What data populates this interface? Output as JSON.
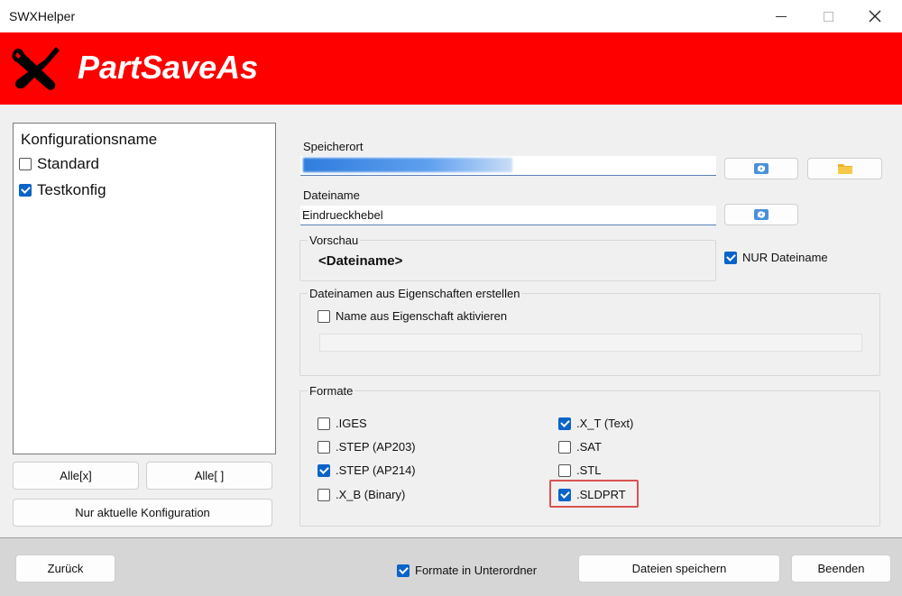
{
  "window": {
    "title": "SWXHelper"
  },
  "banner": {
    "app_title": "PartSaveAs",
    "bg_color": "#ff0000"
  },
  "config": {
    "header": "Konfigurationsname",
    "items": [
      {
        "label": "Standard",
        "checked": false
      },
      {
        "label": "Testkonfig",
        "checked": true
      }
    ],
    "btn_all_checked": "Alle[x]",
    "btn_all_unchecked": "Alle[ ]",
    "btn_current_only": "Nur aktuelle Konfiguration"
  },
  "speicherort": {
    "label": "Speicherort",
    "value": ""
  },
  "dateiname": {
    "label": "Dateiname",
    "value": "Eindrueckhebel"
  },
  "vorschau": {
    "title": "Vorschau",
    "text": "<Dateiname>",
    "nur_dateiname_label": "NUR Dateiname",
    "nur_dateiname_checked": true
  },
  "eigenschaften": {
    "title": "Dateinamen aus Eigenschaften erstellen",
    "activate_label": "Name aus Eigenschaft aktivieren",
    "activate_checked": false
  },
  "formate": {
    "title": "Formate",
    "left": [
      {
        "label": ".IGES",
        "checked": false
      },
      {
        "label": ".STEP (AP203)",
        "checked": false
      },
      {
        "label": ".STEP (AP214)",
        "checked": true
      },
      {
        "label": ".X_B (Binary)",
        "checked": false
      }
    ],
    "right": [
      {
        "label": ".X_T (Text)",
        "checked": true
      },
      {
        "label": ".SAT",
        "checked": false
      },
      {
        "label": ".STL",
        "checked": false
      },
      {
        "label": ".SLDPRT",
        "checked": true
      }
    ]
  },
  "footer": {
    "back_label": "Zurück",
    "subfolder_label": "Formate in Unterordner",
    "subfolder_checked": true,
    "save_label": "Dateien speichern",
    "exit_label": "Beenden"
  },
  "colors": {
    "accent": "#0a64c8",
    "highlight": "#d9534f"
  }
}
